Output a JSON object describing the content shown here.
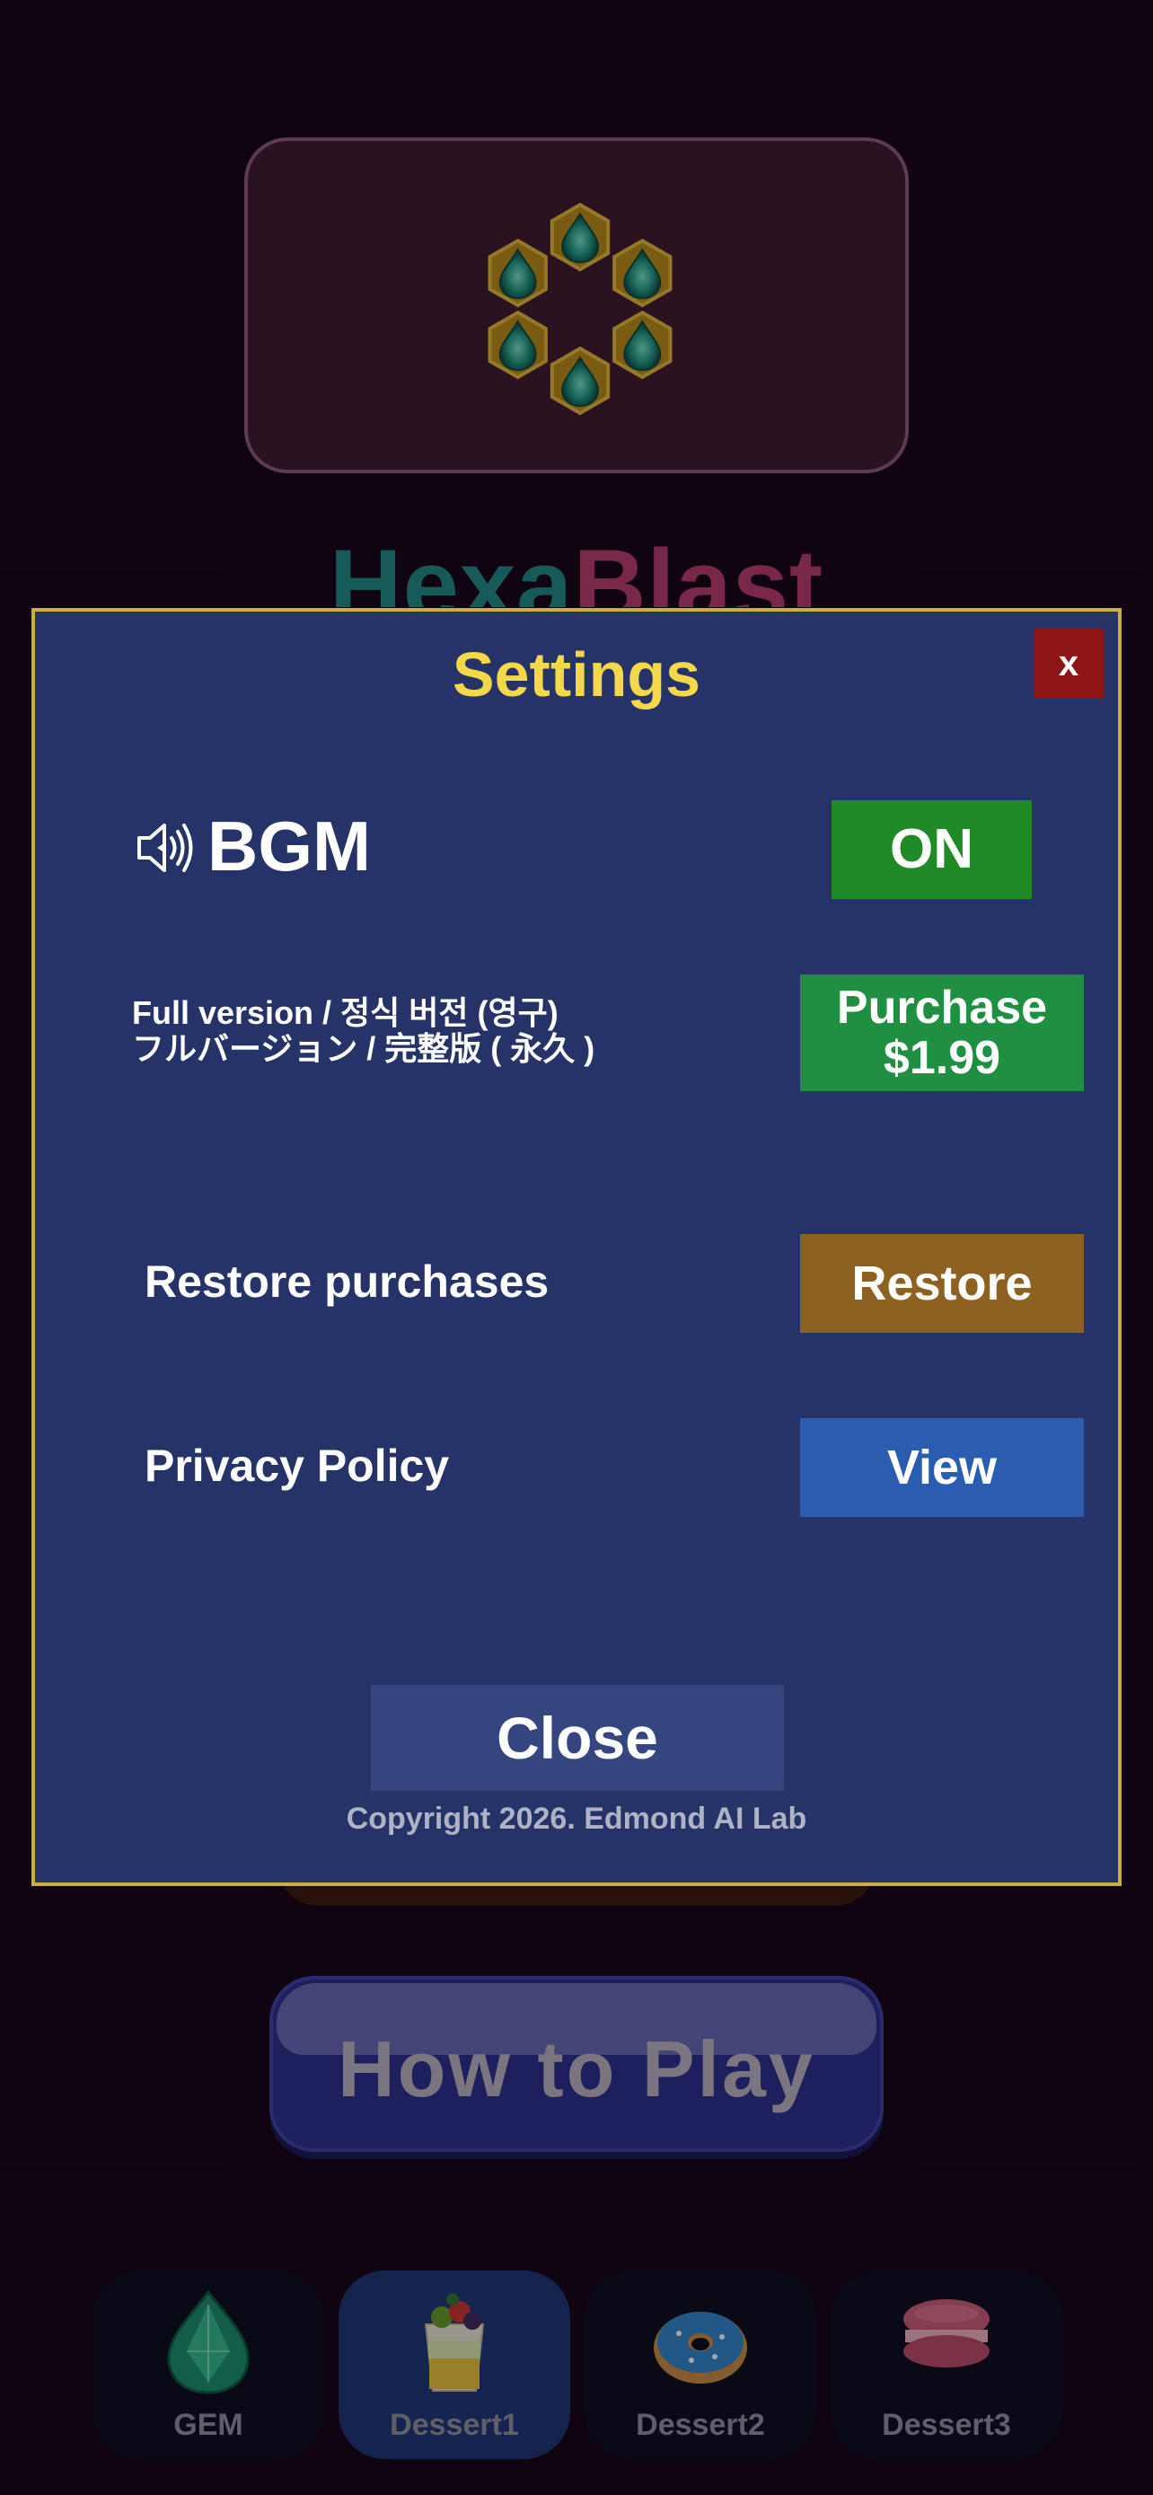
{
  "background": {
    "game_title_part1": "Hexa",
    "game_title_part2": "Blast",
    "how_to_play_label": "How to Play",
    "tabs": [
      {
        "label": "GEM",
        "icon": "gem-icon",
        "active": false
      },
      {
        "label": "Dessert1",
        "icon": "parfait-icon",
        "active": true
      },
      {
        "label": "Dessert2",
        "icon": "donut-icon",
        "active": false
      },
      {
        "label": "Dessert3",
        "icon": "macaron-icon",
        "active": false
      }
    ]
  },
  "settings": {
    "title": "Settings",
    "close_x": "x",
    "bgm": {
      "label": "BGM",
      "icon": "speaker-icon",
      "toggle_label": "ON"
    },
    "purchase": {
      "line1": "Full version / 정식 버전 (영구)",
      "line2": "フルバージョン / 完整版 ( 永久 )",
      "button_line1": "Purchase",
      "button_line2": "$1.99"
    },
    "restore": {
      "label": "Restore purchases",
      "button": "Restore"
    },
    "privacy": {
      "label": "Privacy Policy",
      "button": "View"
    },
    "close_button": "Close",
    "copyright": "Copyright 2026. Edmond AI Lab"
  },
  "colors": {
    "modal_bg": "#263368",
    "modal_border": "#c9b13c",
    "title": "#f3d84a",
    "on_button": "#1f8a26",
    "purchase_button": "#1f9041",
    "restore_button": "#8d6220",
    "view_button": "#2a5daf",
    "close_x": "#8e1516"
  }
}
